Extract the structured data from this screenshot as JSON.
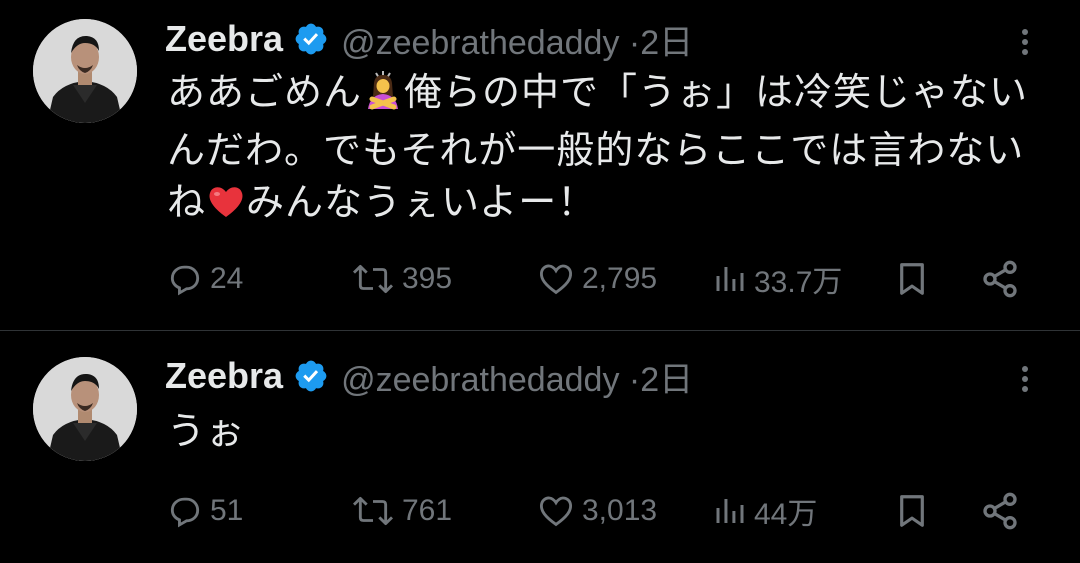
{
  "colors": {
    "background": "#000000",
    "text": "#e7e9ea",
    "secondary": "#71767b",
    "verified_badge": "#1d9bf0",
    "divider": "#2f3336"
  },
  "tweets": [
    {
      "author": {
        "name": "Zeebra",
        "handle": "@zeebrathedaddy",
        "separator": "·",
        "time": "2日",
        "verified_icon": "verified-badge-icon",
        "avatar_icon": "avatar-image"
      },
      "text_parts": {
        "part1": "ああごめん",
        "emoji1": "person-gesturing-no-emoji",
        "part2": "俺らの中で「うぉ」は冷笑じゃないんだわ。でもそれが一般的ならここでは言わないね",
        "emoji2": "red-heart-emoji",
        "part3": "みんなうぇいよー！"
      },
      "stats": {
        "replies": "24",
        "reposts": "395",
        "likes": "2,795",
        "views": "33.7万"
      }
    },
    {
      "author": {
        "name": "Zeebra",
        "handle": "@zeebrathedaddy",
        "separator": "·",
        "time": "2日",
        "verified_icon": "verified-badge-icon",
        "avatar_icon": "avatar-image"
      },
      "text": "うぉ",
      "stats": {
        "replies": "51",
        "reposts": "761",
        "likes": "3,013",
        "views": "44万"
      }
    }
  ],
  "icons": {
    "reply": "reply-icon",
    "repost": "repost-icon",
    "like": "like-icon",
    "views": "views-icon",
    "bookmark": "bookmark-icon",
    "share": "share-icon",
    "more": "more-options-icon"
  }
}
